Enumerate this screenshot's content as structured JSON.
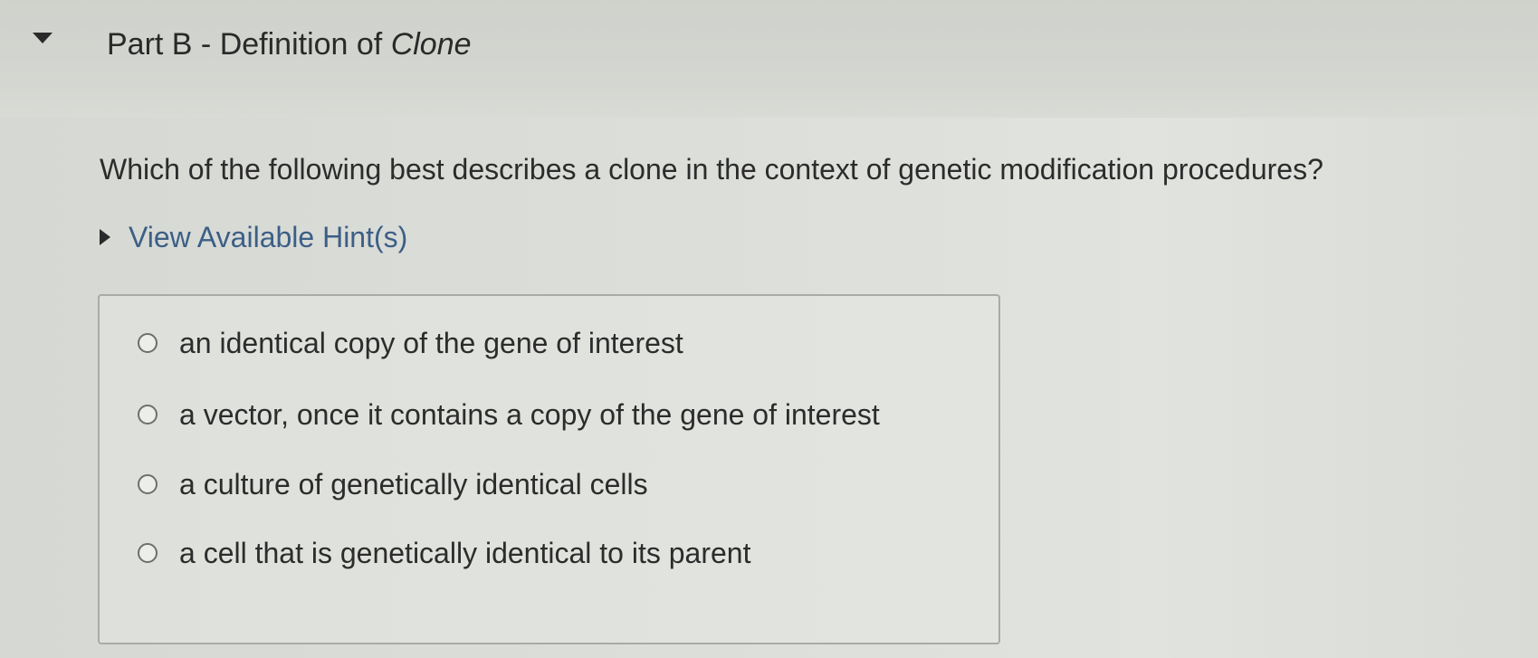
{
  "part": {
    "title_prefix": "Part B - Definition of ",
    "title_italic": "Clone"
  },
  "question": {
    "text": "Which of the following best describes a clone in the context of genetic modification procedures?"
  },
  "hints": {
    "label": "View Available Hint(s)"
  },
  "options": [
    {
      "label": "an identical copy of the gene of interest",
      "selected": false
    },
    {
      "label": "a vector, once it contains a copy of the gene of interest",
      "selected": false
    },
    {
      "label": "a culture of genetically identical cells",
      "selected": false
    },
    {
      "label": "a cell that is genetically identical to its parent",
      "selected": false
    }
  ],
  "icons": {
    "collapse": "triangle-down-icon",
    "hints": "triangle-right-icon",
    "option": "radio-icon"
  },
  "colors": {
    "hint_link": "#3b5f86",
    "text": "#2c2c2c",
    "box_border": "#a9aba7"
  }
}
